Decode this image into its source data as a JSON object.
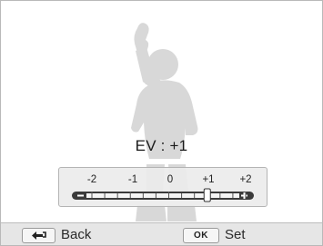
{
  "ev": {
    "readout": "EV : +1",
    "scale_labels": [
      "-2",
      "-1",
      "0",
      "+1",
      "+2"
    ],
    "value": 1,
    "range": [
      -2,
      2
    ]
  },
  "bottom_bar": {
    "back_label": "Back",
    "back_icon": "return-arrow-icon",
    "set_label": "Set",
    "ok_key": "OK"
  },
  "colors": {
    "silhouette": "#d6d6d6",
    "panel_bg": "#ebebeb",
    "bar_dark": "#3a3a3a"
  }
}
